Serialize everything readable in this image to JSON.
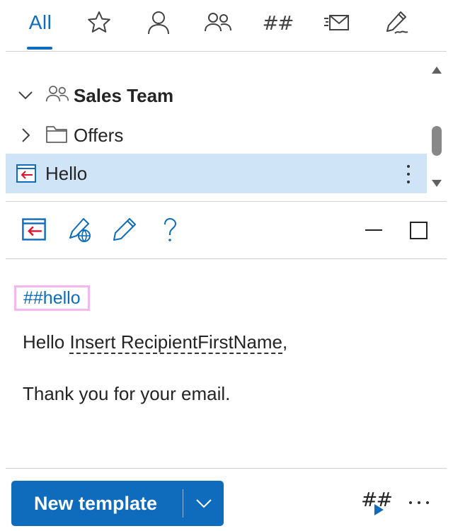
{
  "tabs": {
    "all_label": "All",
    "hash_label": "##",
    "items": [
      "star-icon",
      "person-icon",
      "people-icon",
      "hashtag-icon",
      "email-icon",
      "signature-icon"
    ],
    "active": "All"
  },
  "tree": {
    "items": [
      {
        "label": "Sales Team",
        "icon": "people-icon",
        "expanded": true
      },
      {
        "label": "Offers",
        "icon": "folder-icon",
        "expanded": false
      },
      {
        "label": "Hello",
        "icon": "template-icon",
        "selected": true
      }
    ]
  },
  "preview": {
    "hashtag": "##hello",
    "greeting": "Hello",
    "variable": "Insert RecipientFirstName",
    "comma": ",",
    "body": "Thank you for your email."
  },
  "footer": {
    "new_template_label": "New template",
    "hash_label": "##"
  },
  "colors": {
    "accent": "#0f6cbd",
    "selected_row": "#cfe4f7",
    "hashtag_border": "#f2b8ef",
    "insert_arrow": "#e3122c"
  }
}
